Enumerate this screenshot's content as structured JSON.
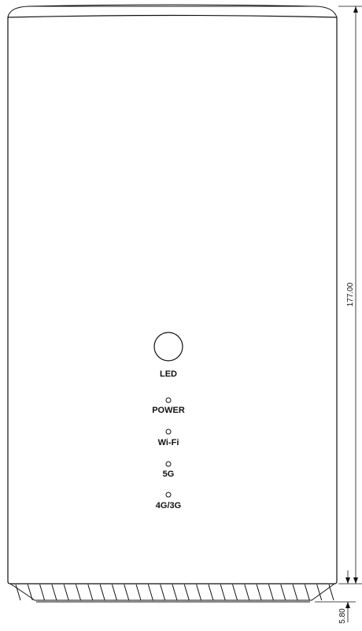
{
  "device": {
    "led_button_label": "LED",
    "indicators": [
      {
        "label": "POWER"
      },
      {
        "label": "Wi-Fi"
      },
      {
        "label": "5G"
      },
      {
        "label": "4G/3G"
      }
    ]
  },
  "dimensions": {
    "height": "177.00",
    "base_height": "5.80"
  }
}
